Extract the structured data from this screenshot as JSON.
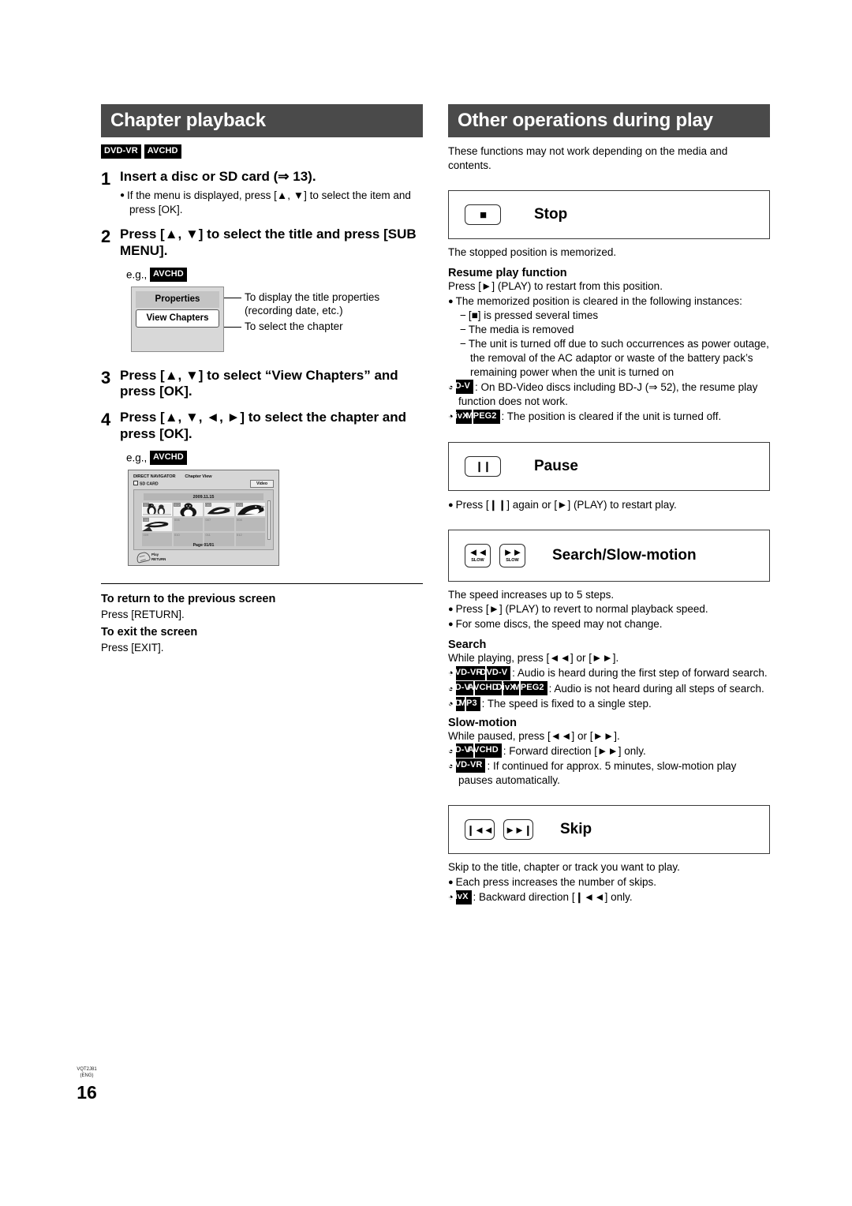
{
  "document": {
    "page_number": "16",
    "footer_code_line1": "VQT2J81",
    "footer_code_line2": "(ENG)"
  },
  "left": {
    "banner_title": "Chapter playback",
    "media_tags": [
      "DVD-VR",
      "AVCHD"
    ],
    "steps": [
      {
        "num": "1",
        "heading": "Insert a disc or SD card (⇒ 13).",
        "bullets": [
          "If the menu is displayed, press [▲, ▼] to select the item and press [OK]."
        ]
      },
      {
        "num": "2",
        "heading": "Press [▲, ▼] to select the title and press [SUB MENU].",
        "bullets": []
      },
      {
        "num": "3",
        "heading": "Press [▲, ▼] to select “View Chapters” and press [OK].",
        "bullets": []
      },
      {
        "num": "4",
        "heading": "Press [▲, ▼, ◄, ►] to select the chapter and press [OK].",
        "bullets": []
      }
    ],
    "eg_label": "e.g.,",
    "eg_tag": "AVCHD",
    "submenu_popup": {
      "items": [
        "Properties",
        "View Chapters"
      ],
      "callout_1_line1": "To display the title properties",
      "callout_1_line2": "(recording date, etc.)",
      "callout_2": "To select the chapter"
    },
    "chapter_view_screen": {
      "title": "DIRECT NAVIGATOR",
      "subtitle": "Chapter View",
      "source": "SD CARD",
      "tab": "Video",
      "date": "2009.11.15",
      "thumbnails": [
        {
          "index": "001",
          "has_image": true
        },
        {
          "index": "002",
          "has_image": true
        },
        {
          "index": "003",
          "has_image": true
        },
        {
          "index": "004",
          "has_image": true
        },
        {
          "index": "005",
          "has_image": true
        },
        {
          "index": "006",
          "has_image": false
        },
        {
          "index": "007",
          "has_image": false
        },
        {
          "index": "008",
          "has_image": false
        },
        {
          "index": "009",
          "has_image": false
        },
        {
          "index": "010",
          "has_image": false
        },
        {
          "index": "011",
          "has_image": false
        },
        {
          "index": "012",
          "has_image": false
        }
      ],
      "page_indicator": "Page 01/01",
      "foot_label_1": "Play",
      "foot_label_2": "RETURN"
    },
    "return_heading": "To return to the previous screen",
    "return_text": "Press [RETURN].",
    "exit_heading": "To exit the screen",
    "exit_text": "Press [EXIT]."
  },
  "right": {
    "banner_title": "Other operations during play",
    "intro": "These functions may not work depending on the media and contents.",
    "stop": {
      "label": "Stop",
      "key_glyph": "■",
      "after": "The stopped position is memorized.",
      "resume_heading": "Resume play function",
      "resume_text": "Press [►] (PLAY) to restart from this position.",
      "bullet_1": "The memorized position is cleared in the following instances:",
      "dashes": [
        "[■] is pressed several times",
        "The media is removed",
        "The unit is turned off due to such occurrences as power outage, the removal of the AC adaptor or waste of the battery pack’s remaining power when the unit is turned on"
      ],
      "bullet_bdv_tag": "BD-V",
      "bullet_bdv_text": ": On BD-Video discs including BD-J (⇒ 52), the resume play function does not work.",
      "bullet_divx_tags": [
        "DivX",
        "MPEG2"
      ],
      "bullet_divx_text": ": The position is cleared if the unit is turned off."
    },
    "pause": {
      "label": "Pause",
      "key_glyph": "❙❙",
      "bullet": "Press [❙❙] again or [►] (PLAY) to restart play."
    },
    "search_slow": {
      "label": "Search/Slow-motion",
      "key_left_glyph": "◄◄",
      "key_right_glyph": "►►",
      "key_sub_label": "SLOW",
      "after": "The speed increases up to 5 steps.",
      "bullet_1": "Press [►] (PLAY) to revert to normal playback speed.",
      "bullet_2": "For some discs, the speed may not change.",
      "search_heading": "Search",
      "search_text": "While playing, press [◄◄] or [►►].",
      "search_b1_tags": [
        "DVD-VR",
        "DVD-V"
      ],
      "search_b1_text": ": Audio is heard during the first step of forward search.",
      "search_b2_tags": [
        "BD-V",
        "AVCHD",
        "DivX",
        "MPEG2"
      ],
      "search_b2_text": ": Audio is not heard during all steps of search.",
      "search_b3_tags": [
        "CD",
        "MP3"
      ],
      "search_b3_text": ": The speed is fixed to a single step.",
      "slow_heading": "Slow-motion",
      "slow_text": "While paused, press [◄◄] or [►►].",
      "slow_b1_tags": [
        "BD-V",
        "AVCHD"
      ],
      "slow_b1_text": ": Forward direction [►►] only.",
      "slow_b2_tags": [
        "DVD-VR"
      ],
      "slow_b2_text": ": If continued for approx. 5 minutes, slow-motion play pauses automatically."
    },
    "skip": {
      "label": "Skip",
      "key_left_glyph": "❙◄◄",
      "key_right_glyph": "►►❙",
      "after": "Skip to the title, chapter or track you want to play.",
      "bullet_1": "Each press increases the number of skips.",
      "bullet_2_tag": "DivX",
      "bullet_2_text": ": Backward direction [❙◄◄] only."
    }
  }
}
